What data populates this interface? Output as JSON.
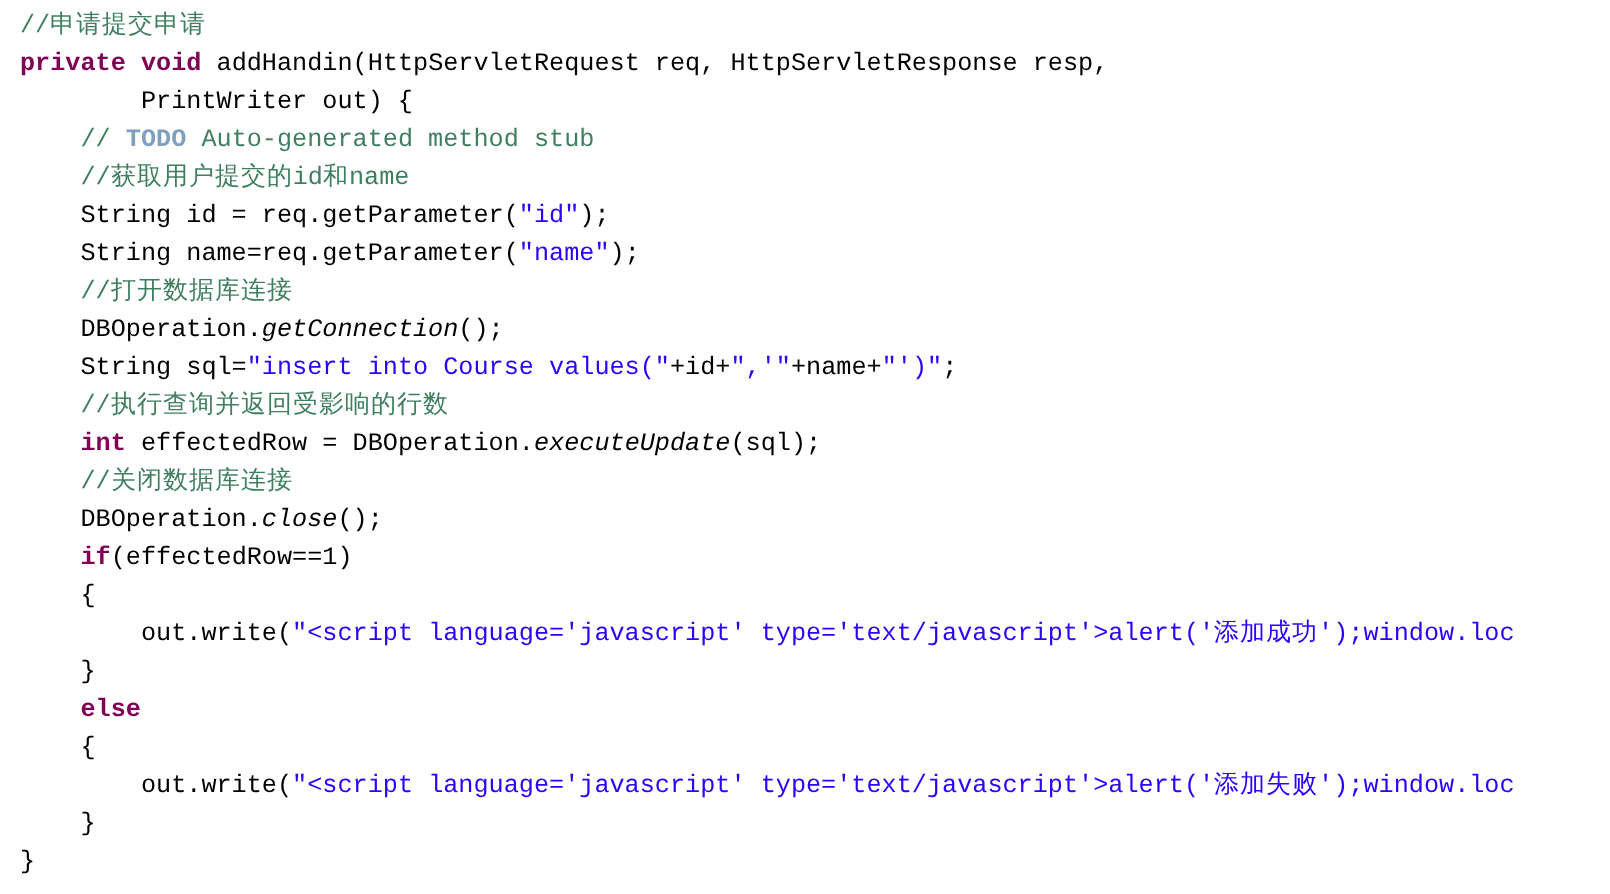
{
  "editor": {
    "lines": [
      [
        {
          "kind": "comment",
          "text": "//申请提交申请"
        }
      ],
      [
        {
          "kind": "keyword",
          "text": "private"
        },
        {
          "kind": "keyword",
          "text": " void"
        },
        {
          "kind": "plain",
          "text": " addHandin(HttpServletRequest req, HttpServletResponse resp,"
        }
      ],
      [
        {
          "kind": "plain",
          "text": "        PrintWriter out) {"
        }
      ],
      [
        {
          "kind": "comment",
          "text": "    // "
        },
        {
          "kind": "todo",
          "text": "TODO"
        },
        {
          "kind": "comment",
          "text": " Auto-generated method stub"
        }
      ],
      [
        {
          "kind": "comment",
          "text": "    //获取用户提交的id和name"
        }
      ],
      [
        {
          "kind": "plain",
          "text": "    String id = req.getParameter("
        },
        {
          "kind": "string",
          "text": "\"id\""
        },
        {
          "kind": "plain",
          "text": ");"
        }
      ],
      [
        {
          "kind": "plain",
          "text": "    String name=req.getParameter("
        },
        {
          "kind": "string",
          "text": "\"name\""
        },
        {
          "kind": "plain",
          "text": ");"
        }
      ],
      [
        {
          "kind": "comment",
          "text": "    //打开数据库连接"
        }
      ],
      [
        {
          "kind": "plain",
          "text": "    DBOperation."
        },
        {
          "kind": "italic",
          "text": "getConnection"
        },
        {
          "kind": "plain",
          "text": "();"
        }
      ],
      [
        {
          "kind": "plain",
          "text": "    String sql="
        },
        {
          "kind": "string",
          "text": "\"insert into Course values(\""
        },
        {
          "kind": "plain",
          "text": "+id+"
        },
        {
          "kind": "string",
          "text": "\",'\""
        },
        {
          "kind": "plain",
          "text": "+name+"
        },
        {
          "kind": "string",
          "text": "\"')\""
        },
        {
          "kind": "plain",
          "text": ";"
        }
      ],
      [
        {
          "kind": "comment",
          "text": "    //执行查询并返回受影响的行数"
        }
      ],
      [
        {
          "kind": "keyword",
          "text": "    int"
        },
        {
          "kind": "plain",
          "text": " effectedRow = DBOperation."
        },
        {
          "kind": "italic",
          "text": "executeUpdate"
        },
        {
          "kind": "plain",
          "text": "(sql);"
        }
      ],
      [
        {
          "kind": "comment",
          "text": "    //关闭数据库连接"
        }
      ],
      [
        {
          "kind": "plain",
          "text": "    DBOperation."
        },
        {
          "kind": "italic",
          "text": "close"
        },
        {
          "kind": "plain",
          "text": "();"
        }
      ],
      [
        {
          "kind": "keyword",
          "text": "    if"
        },
        {
          "kind": "plain",
          "text": "(effectedRow==1)"
        }
      ],
      [
        {
          "kind": "plain",
          "text": "    {"
        }
      ],
      [
        {
          "kind": "plain",
          "text": "        out.write("
        },
        {
          "kind": "string",
          "text": "\"<script language='javascript' type='text/javascript'>alert('添加成功');window.loc"
        }
      ],
      [
        {
          "kind": "plain",
          "text": "    }"
        }
      ],
      [
        {
          "kind": "keyword",
          "text": "    else"
        }
      ],
      [
        {
          "kind": "plain",
          "text": "    {"
        }
      ],
      [
        {
          "kind": "plain",
          "text": "        out.write("
        },
        {
          "kind": "string",
          "text": "\"<script language='javascript' type='text/javascript'>alert('添加失败');window.loc"
        }
      ],
      [
        {
          "kind": "plain",
          "text": "    }"
        }
      ],
      [
        {
          "kind": "plain",
          "text": "}"
        }
      ]
    ]
  }
}
